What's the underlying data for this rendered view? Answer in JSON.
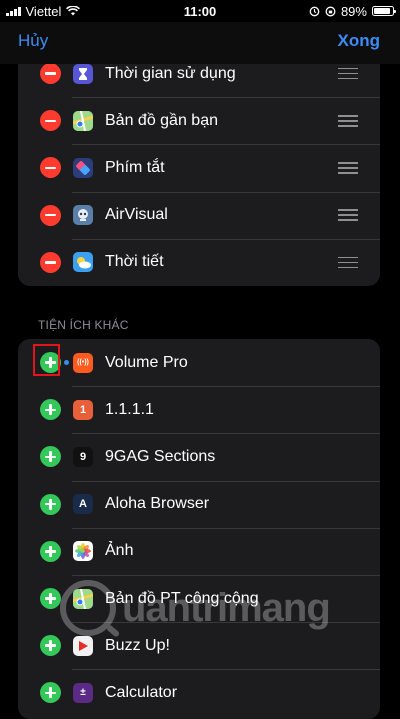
{
  "status": {
    "carrier": "Viettel",
    "time": "11:00",
    "battery": "89%",
    "battery_level": 0.89
  },
  "nav": {
    "cancel_label": "Hủy",
    "done_label": "Xong"
  },
  "active_widgets": [
    {
      "label": "Thời gian sử dụng",
      "icon": "hourglass-icon",
      "color": "#5856d6"
    },
    {
      "label": "Bản đồ gần bạn",
      "icon": "maps-icon",
      "color": "#3fa9f5"
    },
    {
      "label": "Phím tắt",
      "icon": "shortcuts-icon",
      "color": "#2c3e7a"
    },
    {
      "label": "AirVisual",
      "icon": "airvisual-icon",
      "color": "#5a7fa8"
    },
    {
      "label": "Thời tiết",
      "icon": "weather-icon",
      "color": "#3aa0f0"
    }
  ],
  "section_header": "TIỆN ÍCH KHÁC",
  "more_widgets": [
    {
      "label": "Volume Pro",
      "icon": "volume-pro-icon",
      "color": "#ff5a1f",
      "glyph": "((•))"
    },
    {
      "label": "1.1.1.1",
      "icon": "warp-icon",
      "color": "#e8603a",
      "glyph": "1"
    },
    {
      "label": "9GAG Sections",
      "icon": "9gag-icon",
      "color": "#111111",
      "glyph": "9"
    },
    {
      "label": "Aloha Browser",
      "icon": "aloha-icon",
      "color": "#1a2a4a",
      "glyph": "A"
    },
    {
      "label": "Ảnh",
      "icon": "photos-icon",
      "color": "#ffffff",
      "glyph": "✿"
    },
    {
      "label": "Bản đồ PT công cộng",
      "icon": "transit-maps-icon",
      "color": "#3fa9f5",
      "glyph": ""
    },
    {
      "label": "Buzz Up!",
      "icon": "buzzup-icon",
      "color": "#f2f2f2",
      "glyph": "▶"
    },
    {
      "label": "Calculator",
      "icon": "calculator-icon",
      "color": "#5b2a86",
      "glyph": "±"
    }
  ],
  "watermark": "uantrimang",
  "colors": {
    "accent": "#3b8cf5",
    "remove": "#ff3b30",
    "add": "#34c759",
    "highlight": "#e0161b"
  }
}
